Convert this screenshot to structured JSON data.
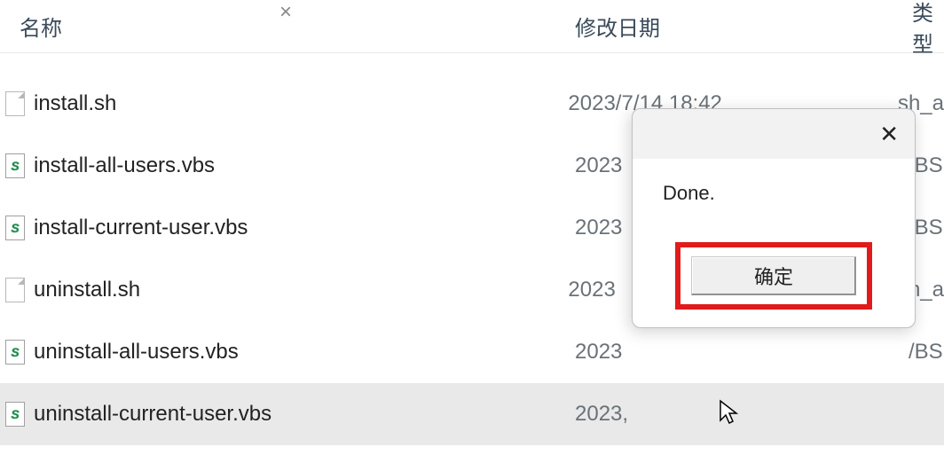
{
  "columns": {
    "name": "名称",
    "date": "修改日期",
    "type": "类型"
  },
  "sort_indicator": "×",
  "files": [
    {
      "icon": "blank",
      "name": "install.sh",
      "date": "2023/7/14 18:42",
      "type": "sh_a"
    },
    {
      "icon": "vbs",
      "name": "install-all-users.vbs",
      "date": "2023",
      "type": "/BS"
    },
    {
      "icon": "vbs",
      "name": "install-current-user.vbs",
      "date": "2023",
      "type": "/BS"
    },
    {
      "icon": "blank",
      "name": "uninstall.sh",
      "date": "2023",
      "type": "sh_a"
    },
    {
      "icon": "vbs",
      "name": "uninstall-all-users.vbs",
      "date": "2023",
      "type": "/BS"
    },
    {
      "icon": "vbs",
      "name": "uninstall-current-user.vbs",
      "date": "2023,",
      "type": ""
    }
  ],
  "selected_index": 5,
  "dialog": {
    "close_glyph": "✕",
    "message": "Done.",
    "ok_label": "确定"
  }
}
